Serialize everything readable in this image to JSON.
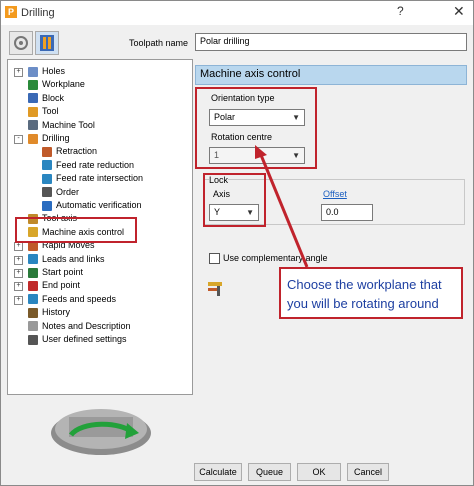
{
  "window": {
    "title": "Drilling",
    "help": "?",
    "close": "✕"
  },
  "toolbar": {
    "icon1": "strategy-selector-icon",
    "icon2": "drilling-strategy-icon"
  },
  "toolpath_name": {
    "label": "Toolpath name",
    "value": "Polar drilling"
  },
  "tree": {
    "items": [
      {
        "label": "Holes",
        "icon_color": "#6c8ec7"
      },
      {
        "label": "Workplane",
        "icon_color": "#2a8a3a"
      },
      {
        "label": "Block",
        "icon_color": "#3a69b5"
      },
      {
        "label": "Tool",
        "icon_color": "#e09a25"
      },
      {
        "label": "Machine Tool",
        "icon_color": "#5a6b7f"
      },
      {
        "label": "Drilling",
        "icon_color": "#e08a2a"
      },
      {
        "label": "Retraction",
        "icon_color": "#c05a2a"
      },
      {
        "label": "Feed rate reduction",
        "icon_color": "#2a86c0"
      },
      {
        "label": "Feed rate intersection",
        "icon_color": "#2a86c0"
      },
      {
        "label": "Order",
        "icon_color": "#555555"
      },
      {
        "label": "Automatic verification",
        "icon_color": "#2a6cc0"
      },
      {
        "label": "Tool axis",
        "icon_color": "#c08a2a"
      },
      {
        "label": "Machine axis control",
        "icon_color": "#d8a62a"
      },
      {
        "label": "Rapid Moves",
        "icon_color": "#c05a2a"
      },
      {
        "label": "Leads and links",
        "icon_color": "#2a86c0"
      },
      {
        "label": "Start point",
        "icon_color": "#2a7a3a"
      },
      {
        "label": "End point",
        "icon_color": "#c02a2a"
      },
      {
        "label": "Feeds and speeds",
        "icon_color": "#2a86c0"
      },
      {
        "label": "History",
        "icon_color": "#7a5a2a"
      },
      {
        "label": "Notes and Description",
        "icon_color": "#999999"
      },
      {
        "label": "User defined settings",
        "icon_color": "#555555"
      }
    ]
  },
  "panel": {
    "header": "Machine axis control",
    "orientation_type": {
      "label": "Orientation type",
      "value": "Polar"
    },
    "rotation_centre": {
      "label": "Rotation centre",
      "value": "1"
    },
    "lock": {
      "label": "Lock",
      "axis_label": "Axis",
      "axis_value": "Y"
    },
    "offset": {
      "label": "Offset",
      "value": "0.0"
    },
    "complementary": {
      "label": "Use complementary angle",
      "checked": false
    }
  },
  "callout": {
    "text": "Choose the workplane that you will be rotating around"
  },
  "buttons": {
    "calculate": "Calculate",
    "queue": "Queue",
    "ok": "OK",
    "cancel": "Cancel"
  },
  "colors": {
    "accent_red": "#c0232c",
    "header_blue": "#b9d7ee",
    "callout_text": "#1d3fa1"
  }
}
